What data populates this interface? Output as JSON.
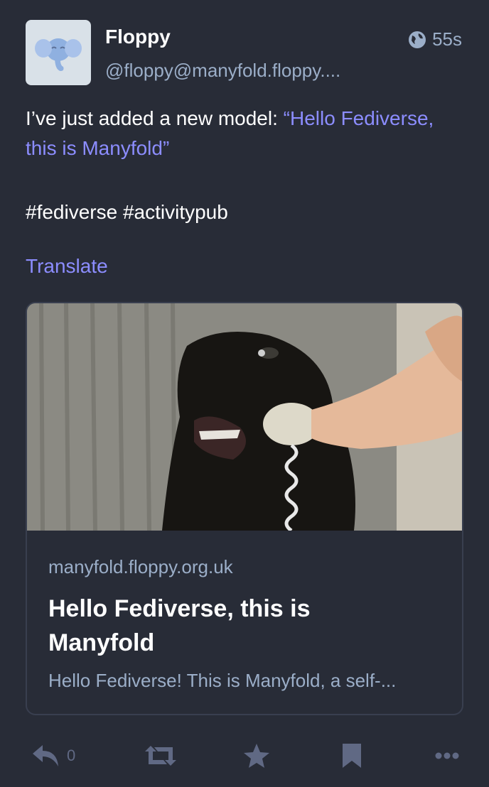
{
  "account": {
    "display_name": "Floppy",
    "handle": "@floppy@manyfold.floppy....",
    "avatar_icon": "mastodon-elephant-icon"
  },
  "status": {
    "visibility_icon": "globe-icon",
    "time": "55s",
    "text_before": "I’ve just added a new model: ",
    "quote": "“Hello Fediverse, this is Manyfold”",
    "hashtags": "#fediverse #activitypub",
    "translate_label": "Translate"
  },
  "card": {
    "image_alt": "dog answering telephone",
    "domain": "manyfold.floppy.org.uk",
    "title": "Hello Fediverse, this is Manyfold",
    "description": "Hello Fediverse! This is Manyfold, a self-..."
  },
  "actions": {
    "reply_icon": "reply-icon",
    "reply_count": "0",
    "boost_icon": "boost-icon",
    "favourite_icon": "star-icon",
    "bookmark_icon": "bookmark-icon",
    "more_icon": "ellipsis-icon"
  },
  "colors": {
    "background": "#282c37",
    "accent": "#8c8dff",
    "secondary_text": "#9baec8",
    "action_icons": "#606984"
  }
}
